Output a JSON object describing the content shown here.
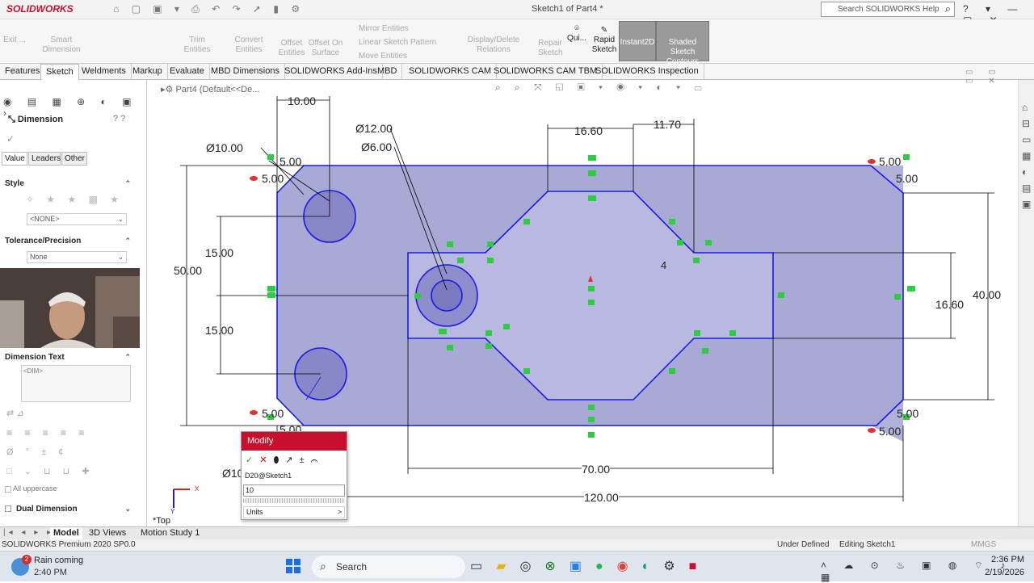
{
  "app": {
    "name": "SOLIDWORKS",
    "doc_title": "Sketch1 of Part4 *",
    "search_placeholder": "Search SOLIDWORKS Help"
  },
  "ribbon": {
    "exit": "Exit ...",
    "smart_dimension": "Smart Dimension",
    "trim": "Trim Entities",
    "convert": "Convert Entities",
    "offset": "Offset Entities",
    "offset_surface": "Offset On Surface",
    "mirror": "Mirror Entities",
    "linear_pattern": "Linear Sketch Pattern",
    "move": "Move Entities",
    "display_delete": "Display/Delete Relations",
    "repair": "Repair Sketch",
    "quick": "Qui...",
    "rapid": "Rapid Sketch",
    "instant2d": "Instant2D",
    "shaded": "Shaded Sketch Contours"
  },
  "tabs": [
    "Features",
    "Sketch",
    "Weldments",
    "Markup",
    "Evaluate",
    "MBD Dimensions",
    "SOLIDWORKS Add-Ins",
    "MBD",
    "SOLIDWORKS CAM",
    "SOLIDWORKS CAM TBM",
    "SOLIDWORKS Inspection"
  ],
  "panel": {
    "title": "Dimension",
    "subtabs": [
      "Value",
      "Leaders",
      "Other"
    ],
    "style": "Style",
    "style_value": "<NONE>",
    "tolerance": "Tolerance/Precision",
    "tolerance_value": "None",
    "dim_text": "Dimension Text",
    "dim_text_value": "<DIM>",
    "all_upper": "All uppercase",
    "dual": "Dual Dimension"
  },
  "tree": {
    "part": "Part4 (Default<<De..."
  },
  "drawing": {
    "dims": [
      "10.00",
      "Ø10.00",
      "5.00",
      "5.00",
      "Ø12.00",
      "Ø6.00",
      "16.60",
      "11.70",
      "5.00",
      "5.00",
      "15.00",
      "50.00",
      "15.00",
      "4",
      "16.60",
      "40.00",
      "5.00",
      "5.00",
      "5.00",
      "5.00",
      "70.00",
      "120.00",
      "Ø10"
    ],
    "view_label": "*Top",
    "axis_x": "X",
    "axis_y": "Y"
  },
  "modify": {
    "title": "Modify",
    "target": "D20@Sketch1",
    "value": "10",
    "units": "Units"
  },
  "bottom_tabs": [
    "Model",
    "3D Views",
    "Motion Study 1"
  ],
  "status": {
    "edition": "SOLIDWORKS Premium 2020 SP0.0",
    "state": "Under Defined",
    "editing": "Editing Sketch1",
    "units": "MMGS"
  },
  "taskbar": {
    "weather_title": "Rain coming",
    "weather_time": "2:40 PM",
    "badge": "2",
    "search": "Search",
    "time": "2:36 PM",
    "date": "2/19/2026"
  },
  "colors": {
    "accent": "#c8102e",
    "sketch_fill": "#a9a9d6",
    "sketch_line": "#1a1ae6",
    "relation": "#2ecc40"
  }
}
